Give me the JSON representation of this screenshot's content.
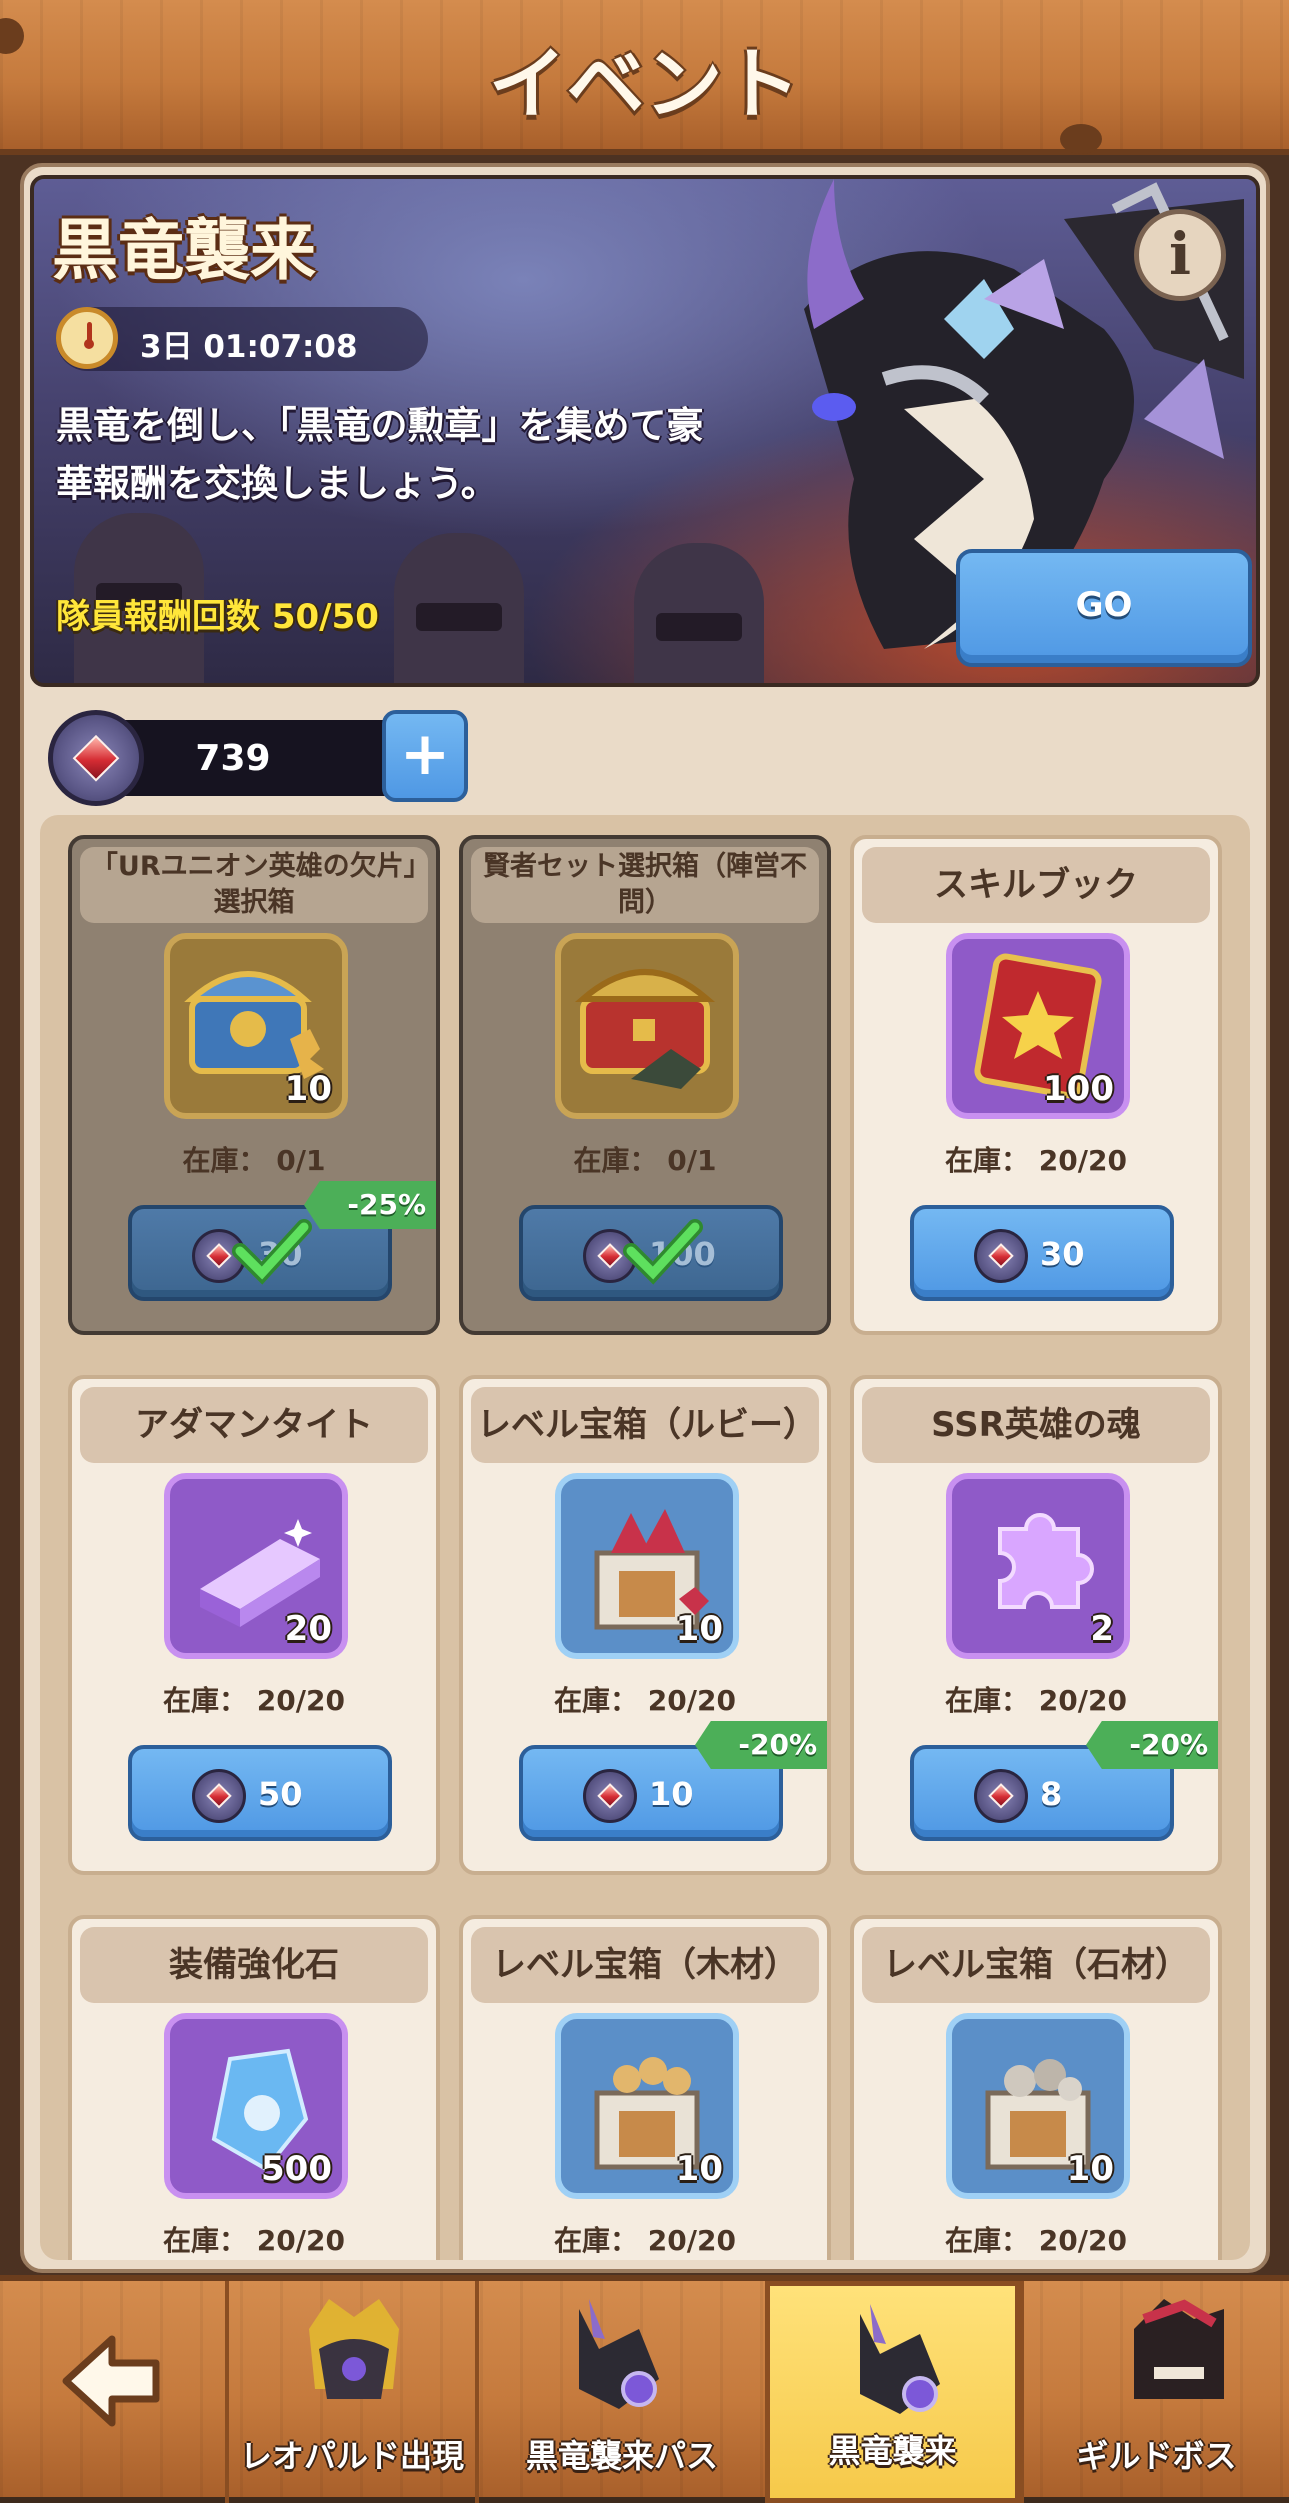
{
  "header": {
    "title": "イベント"
  },
  "banner": {
    "title": "黒竜襲来",
    "timer": "3日 01:07:08",
    "description": "黒竜を倒し、「黒竜の勲章」を集めて豪華報酬を交換しましょう。",
    "reward_count": "隊員報酬回数 50/50",
    "go_label": "GO",
    "info_label": "i"
  },
  "currency": {
    "value": "739",
    "add_label": "+"
  },
  "shop": {
    "items": [
      {
        "title": "「URユニオン英雄の欠片」選択箱",
        "count": "10",
        "stock": "在庫： 0/1",
        "price": "30",
        "discount": "-25%",
        "sold_out": true
      },
      {
        "title": "賢者セット選択箱（陣営不問）",
        "count": "",
        "stock": "在庫： 0/1",
        "price": "100",
        "discount": "",
        "sold_out": true
      },
      {
        "title": "スキルブック",
        "count": "100",
        "stock": "在庫： 20/20",
        "price": "30",
        "discount": "",
        "sold_out": false
      },
      {
        "title": "アダマンタイト",
        "count": "20",
        "stock": "在庫： 20/20",
        "price": "50",
        "discount": "",
        "sold_out": false
      },
      {
        "title": "レベル宝箱（ルビー）",
        "count": "10",
        "stock": "在庫： 20/20",
        "price": "10",
        "discount": "-20%",
        "sold_out": false
      },
      {
        "title": "SSR英雄の魂",
        "count": "2",
        "stock": "在庫： 20/20",
        "price": "8",
        "discount": "-20%",
        "sold_out": false
      },
      {
        "title": "装備強化石",
        "count": "500",
        "stock": "在庫： 20/20",
        "price": "",
        "discount": "",
        "sold_out": false
      },
      {
        "title": "レベル宝箱（木材）",
        "count": "10",
        "stock": "在庫： 20/20",
        "price": "",
        "discount": "",
        "sold_out": false
      },
      {
        "title": "レベル宝箱（石材）",
        "count": "10",
        "stock": "在庫： 20/20",
        "price": "",
        "discount": "",
        "sold_out": false
      }
    ]
  },
  "nav": {
    "tabs": [
      {
        "label": "レオパルド出現"
      },
      {
        "label": "黒竜襲来パス"
      },
      {
        "label": "黒竜襲来",
        "active": true
      },
      {
        "label": "ギルドボス"
      }
    ]
  },
  "colors": {
    "accent_blue": "#4f98e4",
    "discount_green": "#4caf58",
    "reward_yellow": "#ffe63a",
    "wood": "#c57a3d"
  }
}
